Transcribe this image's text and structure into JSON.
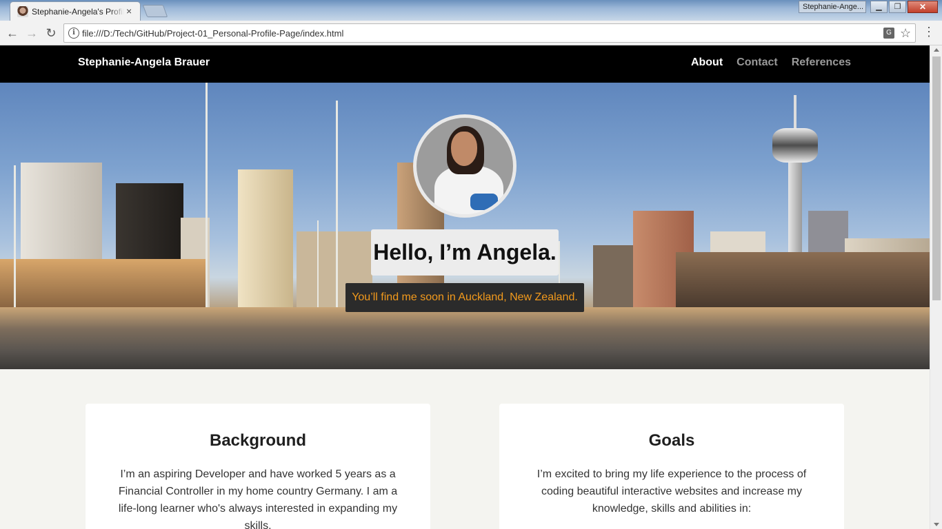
{
  "browser": {
    "tab_title": "Stephanie-Angela's Profile",
    "tab_close": "×",
    "window_label": "Stephanie-Ange...",
    "url": "file:///D:/Tech/GitHub/Project-01_Personal-Profile-Page/index.html"
  },
  "nav": {
    "brand": "Stephanie-Angela Brauer",
    "links": [
      "About",
      "Contact",
      "References"
    ],
    "active": "About"
  },
  "hero": {
    "greeting": "Hello, I’m Angela.",
    "tagline": "You’ll find me soon in Auckland, New Zealand."
  },
  "cards": [
    {
      "title": "Background",
      "text": "I’m an aspiring Developer and have worked 5 years as a Financial Controller in my home country Germany. I am a life-long learner who's always interested in expanding my skills."
    },
    {
      "title": "Goals",
      "text": "I’m excited to bring my life experience to the process of coding beautiful interactive websites and increase my knowledge, skills and abilities in:"
    }
  ],
  "colors": {
    "nav_bg": "#000000",
    "tagline_color": "#f39a1c",
    "page_bg": "#f4f4f0"
  }
}
